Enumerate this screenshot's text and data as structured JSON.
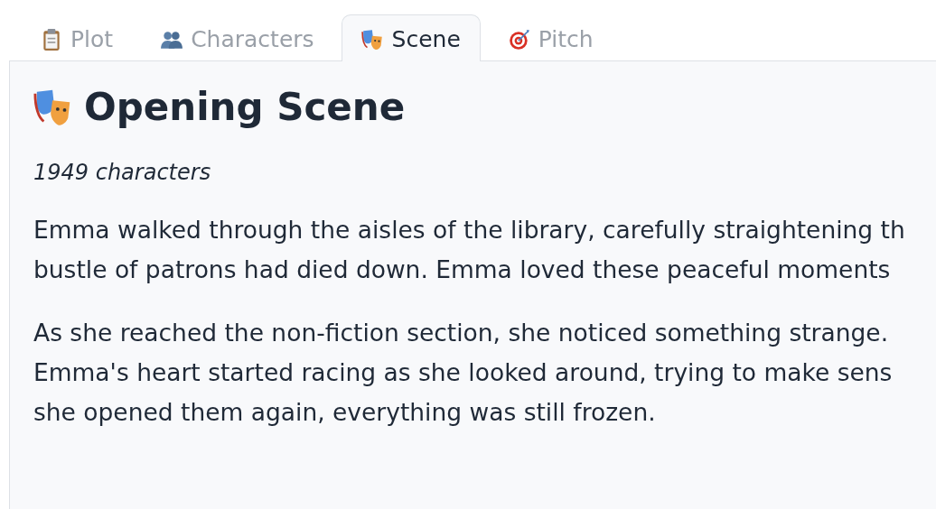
{
  "tabs": [
    {
      "label": "Plot",
      "kind": "clipboard",
      "selected": false
    },
    {
      "label": "Characters",
      "kind": "people",
      "selected": false
    },
    {
      "label": "Scene",
      "kind": "masks",
      "selected": true
    },
    {
      "label": "Pitch",
      "kind": "target",
      "selected": false
    }
  ],
  "scene": {
    "title": "Opening Scene",
    "count": "1949 characters",
    "paragraphs": [
      [
        "Emma walked through the aisles of the library, carefully straightening th",
        "bustle of patrons had died down. Emma loved these peaceful moments"
      ],
      [
        "As she reached the non-fiction section, she noticed something strange.",
        "Emma's heart started racing as she looked around, trying to make sens",
        "she opened them again, everything was still frozen."
      ]
    ]
  }
}
